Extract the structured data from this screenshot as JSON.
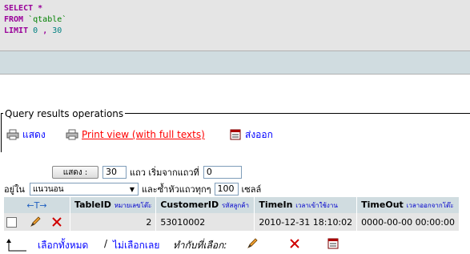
{
  "sql": {
    "select_kw": "SELECT",
    "star": "*",
    "from_kw": "FROM",
    "table": "`qtable`",
    "limit_kw": "LIMIT",
    "limit_a": "0",
    "comma": ",",
    "limit_b": "30"
  },
  "ops": {
    "legend": "Query results operations",
    "show_label": "แสดง",
    "print_view_label": "Print view (with full texts)",
    "export_label": "ส่งออก"
  },
  "form": {
    "show_button": "แสดง :",
    "rows_value": "30",
    "rows_suffix": "แถว เริ่มจากแถวที่",
    "start_value": "0",
    "in_label": "อยู่ใน",
    "mode_value": "แนวนอน",
    "repeat_label": "และซ้ำหัวแถวทุกๆ",
    "repeat_value": "100",
    "cells_label": "เซลล์"
  },
  "table": {
    "nav_symbol": "←T→",
    "columns": [
      {
        "name": "TableID",
        "sub": "หมายเลขโต๊ะ"
      },
      {
        "name": "CustomerID",
        "sub": "รหัสลูกค้า"
      },
      {
        "name": "TimeIn",
        "sub": "เวลาเข้าใช้งาน"
      },
      {
        "name": "TimeOut",
        "sub": "เวลาออกจากโต๊ะ"
      }
    ],
    "rows": [
      {
        "TableID": "2",
        "CustomerID": "53010002",
        "TimeIn": "2010-12-31 18:10:02",
        "TimeOut": "0000-00-00 00:00:00"
      }
    ]
  },
  "footer": {
    "select_all": "เลือกทั้งหมด",
    "sep": "/",
    "deselect_all": "ไม่เลือกเลย",
    "with_selected": "ทำกับที่เลือก:"
  },
  "colors": {
    "header_bg": "#d0dce0",
    "row_bg": "#e5e5e5",
    "keyword": "#990099",
    "link": "#0000ff",
    "print_link": "#ff0000"
  }
}
